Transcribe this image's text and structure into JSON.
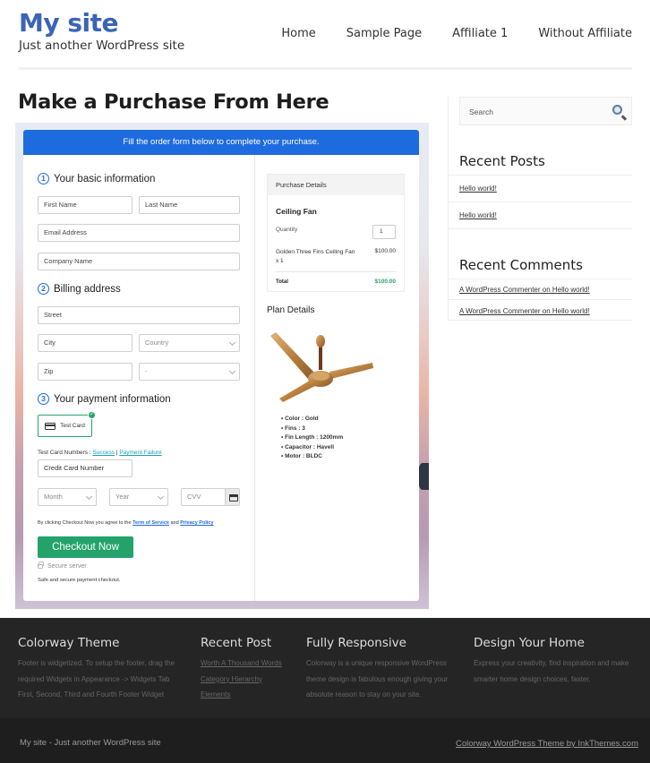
{
  "site": {
    "title": "My site",
    "tagline": "Just another WordPress site"
  },
  "nav": {
    "items": [
      "Home",
      "Sample Page",
      "Affiliate 1",
      "Without Affiliate"
    ]
  },
  "page": {
    "title": "Make a Purchase From Here"
  },
  "form": {
    "banner": "Fill the order form below to complete your purchase.",
    "sections": {
      "basic": {
        "number": "1",
        "title": "Your basic information"
      },
      "billing": {
        "number": "2",
        "title": "Billing address"
      },
      "payment": {
        "number": "3",
        "title": "Your payment information"
      }
    },
    "fields": {
      "first_name": "First Name",
      "last_name": "Last Name",
      "email": "Email Address",
      "company": "Company Name",
      "street": "Street",
      "city": "City",
      "country": "Country",
      "zip": "Zip",
      "state": "-",
      "card_number": "Credit Card Number",
      "month": "Month",
      "year": "Year",
      "cvv": "CVV"
    },
    "payment_method": "Test Card",
    "test_card_label": "Test Card Numbers : ",
    "test_success": "Success",
    "test_separator": " | ",
    "test_failure": "Payment Failure",
    "terms_prefix": "By clicking Checkout Now you agree to the ",
    "terms_link": "Term of Service",
    "terms_and": " and ",
    "privacy_link": "Privacy Policy",
    "checkout_button": "Checkout Now",
    "secure_server": "Secure server",
    "secure_note": "Safe and secure payment checkout."
  },
  "purchase": {
    "header": "Purchase Details",
    "product": "Ceiling Fan",
    "quantity_label": "Quantity",
    "quantity": "1",
    "item_name": "Golden Three Fins Ceiling Fan x 1",
    "item_price": "$100.00",
    "total_label": "Total",
    "total": "$100.00"
  },
  "plan": {
    "title": "Plan Details",
    "specs": [
      "Color : Gold",
      "Fins : 3",
      "Fin Length : 1200mm",
      "Capacitor : Havell",
      "Motor : BLDC"
    ]
  },
  "sidebar": {
    "search_placeholder": "Search",
    "recent_posts_title": "Recent Posts",
    "recent_posts": [
      "Hello world!",
      "Hello world!"
    ],
    "recent_comments_title": "Recent Comments",
    "recent_comments": [
      "A WordPress Commenter on Hello world!",
      "A WordPress Commenter on Hello world!"
    ]
  },
  "footer": {
    "columns": [
      {
        "title": "Colorway Theme",
        "lines": [
          "Footer is widgetized. To setup the footer, drag the",
          "required Widgets in Appearance -> Widgets Tab",
          "First, Second, Third and Fourth Footer Widget"
        ]
      },
      {
        "title": "Recent Post",
        "lines": [
          "Worth A Thousand Words",
          "Category Hierarchy",
          "Elements"
        ]
      },
      {
        "title": "Fully Responsive",
        "lines": [
          "Colorway is a unique responsive WordPress",
          "theme design is fabulous enough giving your",
          "absolute reason to stay on your site."
        ]
      },
      {
        "title": "Design Your Home",
        "lines": [
          "Express your creativity, find inspiration and make",
          "smarter home design choices, faster."
        ]
      }
    ],
    "bottom_left": "My site - Just another WordPress site",
    "bottom_right": "Colorway WordPress Theme by InkThemes.com"
  },
  "colors": {
    "brand_blue": "#3a64b8",
    "banner_blue": "#1e6be0",
    "checkout_green": "#23a36a",
    "footer_bg": "#252525"
  }
}
